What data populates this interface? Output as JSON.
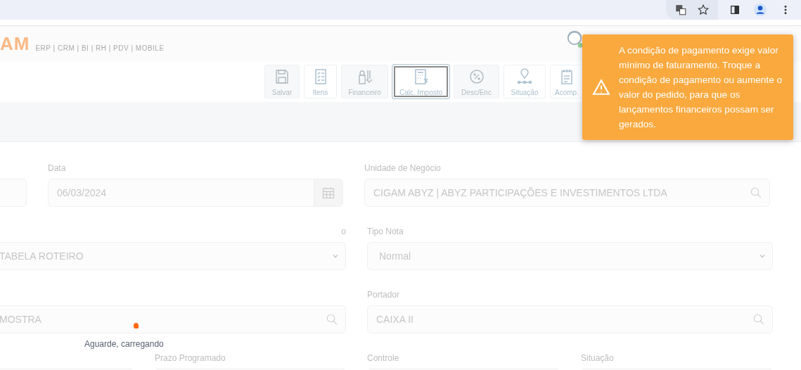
{
  "header": {
    "logo": "AM",
    "tagline": "ERP | CRM | BI | RH | PDV | MOBILE"
  },
  "toolbar": {
    "buttons": [
      {
        "label": "Salvar",
        "disabled": true,
        "focused": false
      },
      {
        "label": "Itens",
        "disabled": false,
        "focused": false
      },
      {
        "label": "Financeiro",
        "disabled": true,
        "focused": false
      },
      {
        "label": "Calc. Imposto",
        "disabled": false,
        "focused": true
      },
      {
        "label": "Desc/Enc",
        "disabled": true,
        "focused": false
      },
      {
        "label": "Situação",
        "disabled": false,
        "focused": false
      },
      {
        "label": "Acomp.",
        "disabled": false,
        "focused": false
      }
    ]
  },
  "form": {
    "rows": [
      {
        "fields": [
          {
            "kind": "text"
          },
          {
            "label": "Data",
            "kind": "date",
            "value": "06/03/2024"
          },
          {
            "label": "Unidade de Negócio",
            "kind": "search",
            "value": "CIGAM ABYZ | ABYZ PARTICIPAÇÕES E INVESTIMENTOS LTDA"
          }
        ]
      },
      {
        "fields": [
          {
            "label": "o",
            "kind": "select",
            "value": "TABELA ROTEIRO"
          },
          {
            "label": "Tipo Nota",
            "kind": "select",
            "value": "Normal"
          }
        ]
      },
      {
        "fields": [
          {
            "kind": "search",
            "value": "MOSTRA"
          },
          {
            "label": "Portador",
            "kind": "search",
            "value": "CAIXA II"
          }
        ]
      },
      {
        "fields": [
          {
            "kind": "text"
          },
          {
            "label": "Prazo Programado",
            "kind": "text"
          },
          {
            "label": "Controle",
            "kind": "text"
          },
          {
            "label": "Situação",
            "kind": "text"
          }
        ]
      }
    ]
  },
  "loading": {
    "text": "Aguarde, carregando"
  },
  "toast": {
    "message": "A condição de pagamento exige valor mínimo de faturamento. Troque a condição de pagamento ou aumente o valor do pedido, para que os lançamentos financeiros possam ser gerados."
  }
}
